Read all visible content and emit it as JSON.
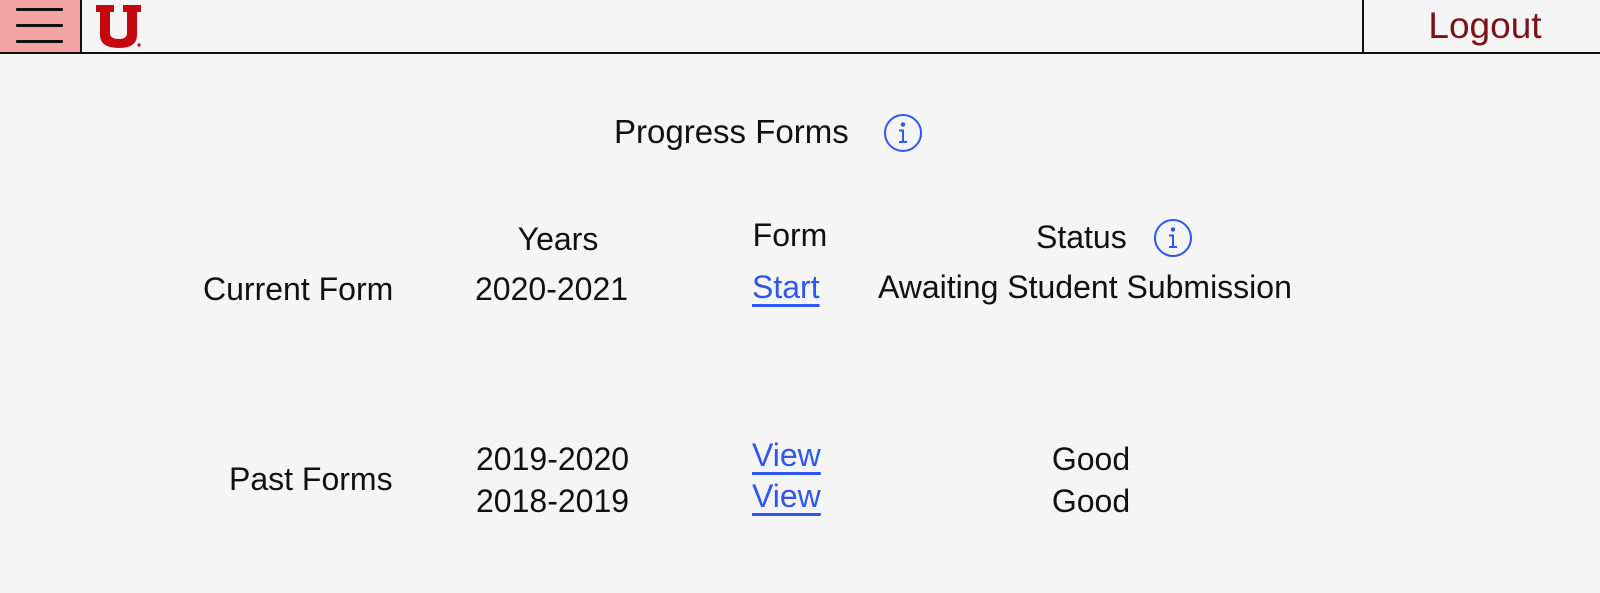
{
  "header": {
    "menu_icon": "hamburger-menu-icon",
    "logo_icon": "university-u-logo",
    "logout_label": "Logout",
    "logout_color": "#7a1216"
  },
  "page": {
    "title": "Progress Forms",
    "info_icon": "info-circle-icon"
  },
  "table": {
    "headers": {
      "years": "Years",
      "form": "Form",
      "status": "Status"
    },
    "current": {
      "section_label": "Current Form",
      "rows": [
        {
          "years": "2020-2021",
          "form_link": "Start",
          "status": "Awaiting Student Submission"
        }
      ]
    },
    "past": {
      "section_label": "Past Forms",
      "rows": [
        {
          "years": "2019-2020",
          "form_link": "View",
          "status": "Good"
        },
        {
          "years": "2018-2019",
          "form_link": "View",
          "status": "Good"
        }
      ]
    }
  },
  "colors": {
    "link": "#2f56f2",
    "menu_bg": "#f4a3a3",
    "logo_red": "#c4080f"
  }
}
